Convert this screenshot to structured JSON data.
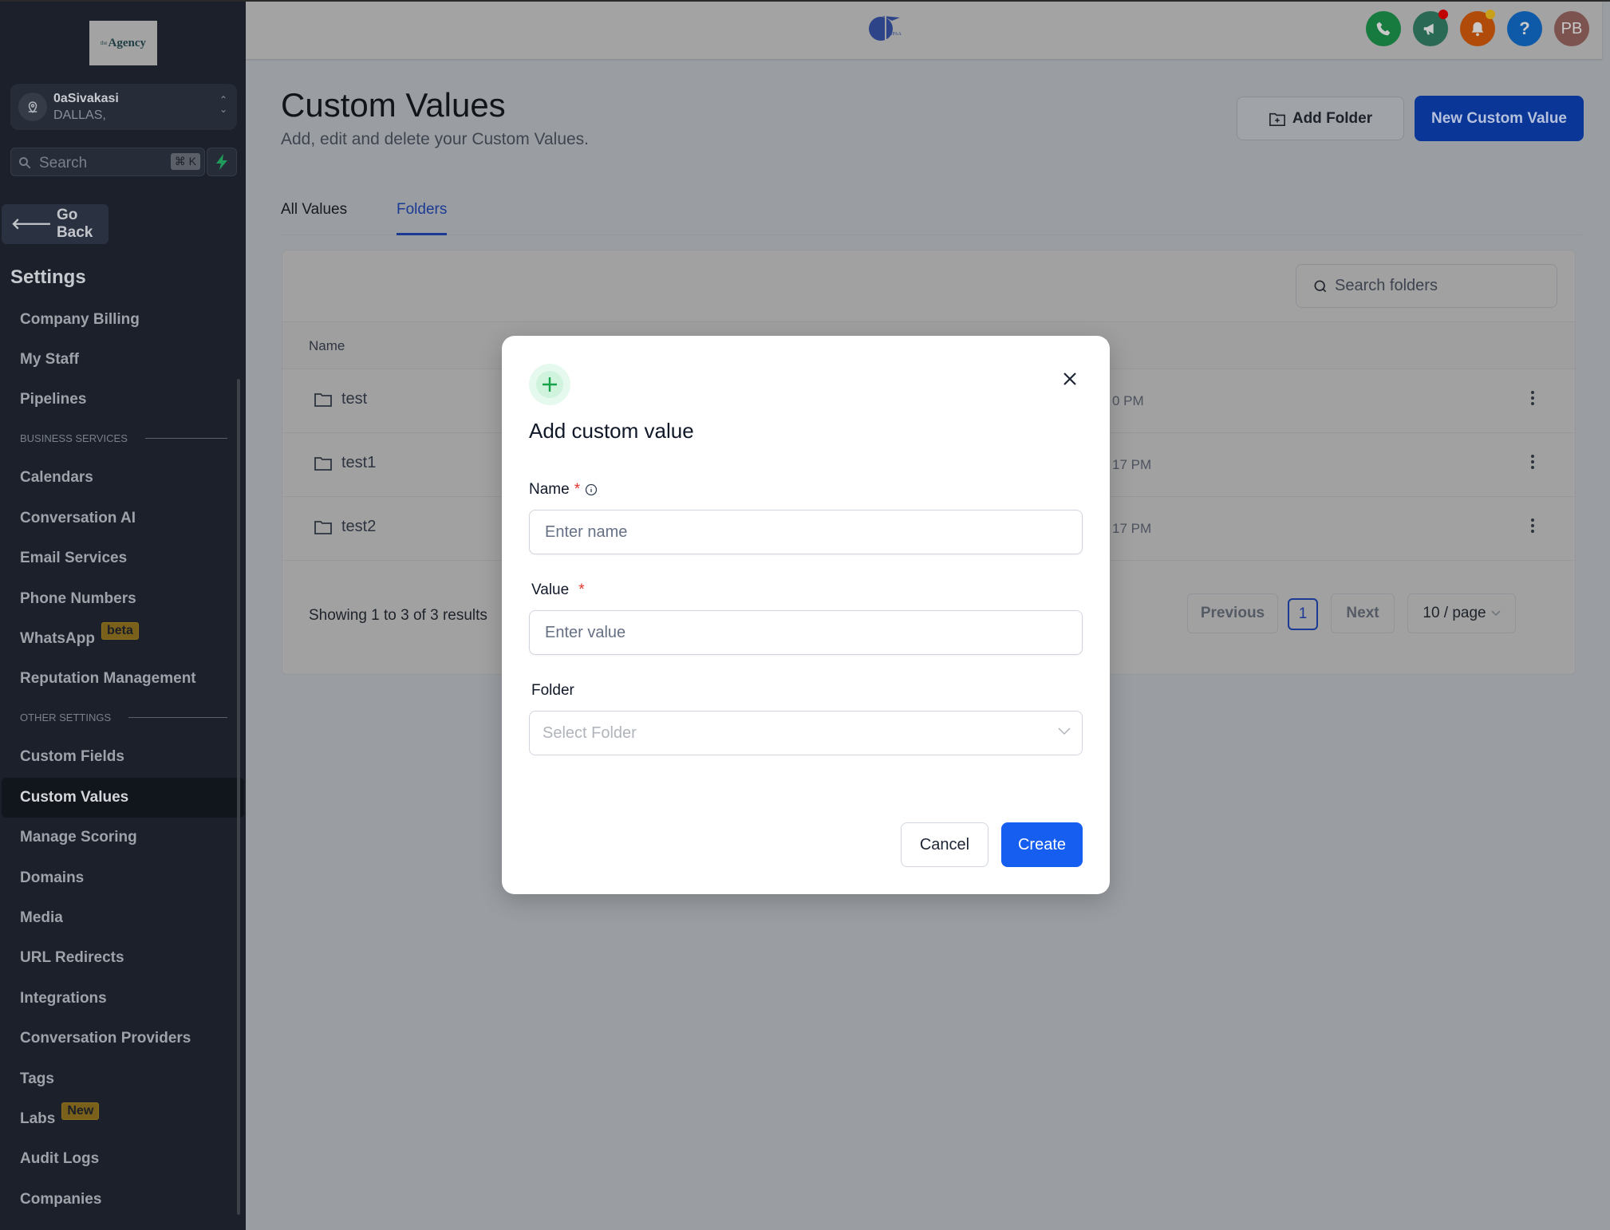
{
  "sidebar": {
    "logo_text": "Agency",
    "logo_prefix": "the",
    "location": {
      "name": "0aSivakasi",
      "sub": "DALLAS,"
    },
    "search": {
      "placeholder": "Search",
      "shortcut": "⌘ K"
    },
    "go_back": "Go Back",
    "settings_title": "Settings",
    "items": [
      {
        "label": "Company Billing"
      },
      {
        "label": "My Staff"
      },
      {
        "label": "Pipelines"
      },
      {
        "label": "Calendars"
      },
      {
        "label": "Conversation AI"
      },
      {
        "label": "Email Services"
      },
      {
        "label": "Phone Numbers"
      },
      {
        "label": "WhatsApp",
        "badge": "beta"
      },
      {
        "label": "Reputation Management"
      },
      {
        "label": "Custom Fields"
      },
      {
        "label": "Custom Values",
        "active": true
      },
      {
        "label": "Manage Scoring"
      },
      {
        "label": "Domains"
      },
      {
        "label": "Media"
      },
      {
        "label": "URL Redirects"
      },
      {
        "label": "Integrations"
      },
      {
        "label": "Conversation Providers"
      },
      {
        "label": "Tags"
      },
      {
        "label": "Labs",
        "badge": "New"
      },
      {
        "label": "Audit Logs"
      },
      {
        "label": "Companies"
      }
    ],
    "sections": {
      "business": "BUSINESS SERVICES",
      "other": "OTHER SETTINGS"
    }
  },
  "topbar": {
    "center_logo": "HIPAA",
    "icons": [
      {
        "name": "phone-icon",
        "color": "#177a3e"
      },
      {
        "name": "megaphone-icon",
        "color": "#2a6a55",
        "dot": "#c00000"
      },
      {
        "name": "bell-icon",
        "color": "#b14b09",
        "dot": "#c9a01a"
      },
      {
        "name": "help-icon",
        "color": "#0f5aa8",
        "text": "?"
      },
      {
        "name": "avatar",
        "color": "#7d5350",
        "text": "PB"
      }
    ]
  },
  "page": {
    "title": "Custom Values",
    "subtitle": "Add, edit and delete your Custom Values.",
    "add_folder": "Add Folder",
    "new_value": "New Custom Value",
    "tabs": [
      {
        "label": "All Values"
      },
      {
        "label": "Folders",
        "active": true
      }
    ],
    "search_placeholder": "Search folders",
    "table": {
      "columns": [
        "Name"
      ],
      "rows": [
        {
          "name": "test",
          "date_fragment": "0 PM"
        },
        {
          "name": "test1",
          "date_fragment": "17 PM"
        },
        {
          "name": "test2",
          "date_fragment": "17 PM"
        }
      ]
    },
    "showing": "Showing 1 to 3 of 3 results",
    "pagination": {
      "previous": "Previous",
      "current": "1",
      "next": "Next",
      "page_size": "10 / page"
    }
  },
  "modal": {
    "title": "Add custom value",
    "name_label": "Name",
    "name_placeholder": "Enter name",
    "value_label": "Value",
    "value_placeholder": "Enter value",
    "folder_label": "Folder",
    "folder_placeholder": "Select Folder",
    "required_mark": "*",
    "cancel": "Cancel",
    "create": "Create"
  }
}
